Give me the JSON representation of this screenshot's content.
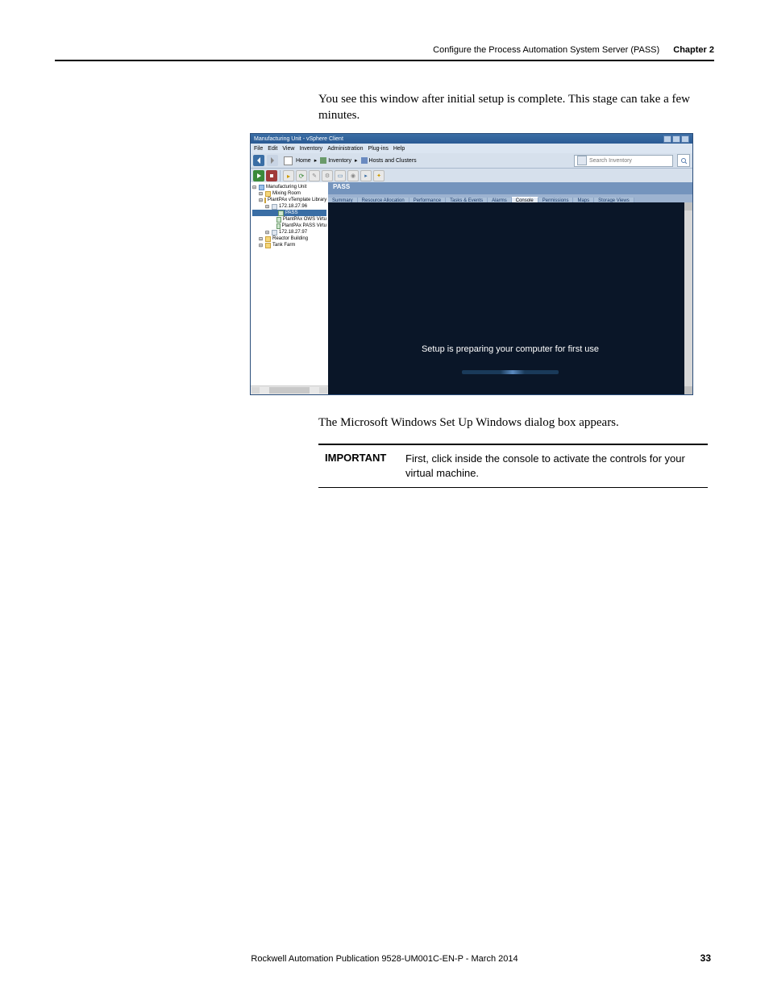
{
  "header": {
    "section_title": "Configure the Process Automation System Server (PASS)",
    "chapter": "Chapter 2"
  },
  "intro": "You see this window after initial setup is complete. This stage can take a few minutes.",
  "vsphere": {
    "window_title": "Manufacturing Unit - vSphere Client",
    "menu": [
      "File",
      "Edit",
      "View",
      "Inventory",
      "Administration",
      "Plug-ins",
      "Help"
    ],
    "breadcrumb": {
      "home": "Home",
      "sep": "▸",
      "inventory": "Inventory",
      "hosts": "Hosts and Clusters"
    },
    "search_placeholder": "Search Inventory",
    "tree": {
      "root": "Manufacturing Unit",
      "items": [
        {
          "label": "Mixing Room",
          "indent": 1,
          "type": "folder"
        },
        {
          "label": "PlantPAx vTemplate Library",
          "indent": 1,
          "type": "folder"
        },
        {
          "label": "172.18.27.96",
          "indent": 2,
          "type": "host"
        },
        {
          "label": "PASS",
          "indent": 3,
          "type": "vm",
          "selected": true
        },
        {
          "label": "PlantPAx OWS Virtu",
          "indent": 3,
          "type": "vm"
        },
        {
          "label": "PlantPAx PASS Virtu",
          "indent": 3,
          "type": "vm"
        },
        {
          "label": "172.18.27.97",
          "indent": 2,
          "type": "host"
        },
        {
          "label": "Reactor Building",
          "indent": 1,
          "type": "folder"
        },
        {
          "label": "Tank Farm",
          "indent": 1,
          "type": "folder"
        }
      ]
    },
    "main_title": "PASS",
    "tabs": [
      "Summary",
      "Resource Allocation",
      "Performance",
      "Tasks & Events",
      "Alarms",
      "Console",
      "Permissions",
      "Maps",
      "Storage Views"
    ],
    "active_tab": "Console",
    "console_msg": "Setup is preparing your computer for first use"
  },
  "after_text": "The Microsoft Windows Set Up Windows dialog box appears.",
  "important": {
    "label": "IMPORTANT",
    "msg": "First, click inside the console to activate the controls for your virtual machine."
  },
  "footer": {
    "publication": "Rockwell Automation Publication 9528-UM001C-EN-P - March 2014",
    "page": "33"
  }
}
